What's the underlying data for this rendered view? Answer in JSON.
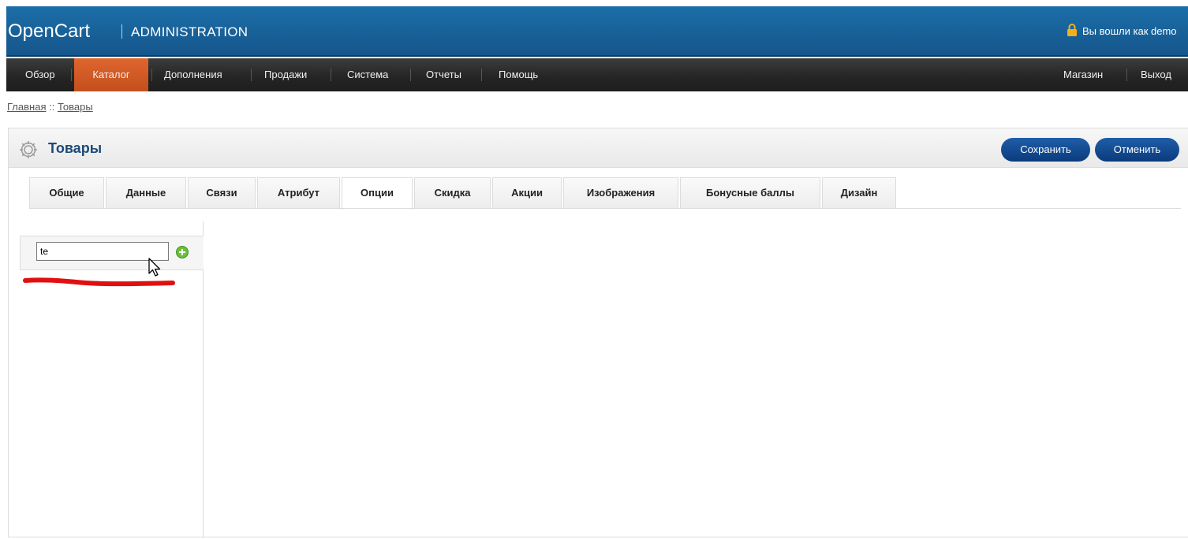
{
  "header": {
    "logo": "OpenCart",
    "subtitle": "ADMINISTRATION",
    "login_text": "Вы вошли как demo"
  },
  "menu": {
    "items": [
      {
        "label": "Обзор",
        "active": false
      },
      {
        "label": "Каталог",
        "active": true
      },
      {
        "label": "Дополнения",
        "active": false
      },
      {
        "label": "Продажи",
        "active": false
      },
      {
        "label": "Система",
        "active": false
      },
      {
        "label": "Отчеты",
        "active": false
      },
      {
        "label": "Помощь",
        "active": false
      }
    ],
    "right_items": [
      {
        "label": "Магазин"
      },
      {
        "label": "Выход"
      }
    ]
  },
  "breadcrumb": {
    "home": "Главная",
    "separator": " :: ",
    "current": "Товары"
  },
  "page": {
    "title": "Товары",
    "save_label": "Сохранить",
    "cancel_label": "Отменить"
  },
  "tabs": [
    {
      "label": "Общие",
      "active": false
    },
    {
      "label": "Данные",
      "active": false
    },
    {
      "label": "Связи",
      "active": false
    },
    {
      "label": "Атрибут",
      "active": false
    },
    {
      "label": "Опции",
      "active": true
    },
    {
      "label": "Скидка",
      "active": false
    },
    {
      "label": "Акции",
      "active": false
    },
    {
      "label": "Изображения",
      "active": false
    },
    {
      "label": "Бонусные баллы",
      "active": false
    },
    {
      "label": "Дизайн",
      "active": false
    }
  ],
  "options": {
    "input_value": "te"
  },
  "colors": {
    "header_blue": "#1c6ea8",
    "menu_active": "#d85a24",
    "button_blue": "#0b3b7c",
    "annotation_red": "#e01010"
  }
}
